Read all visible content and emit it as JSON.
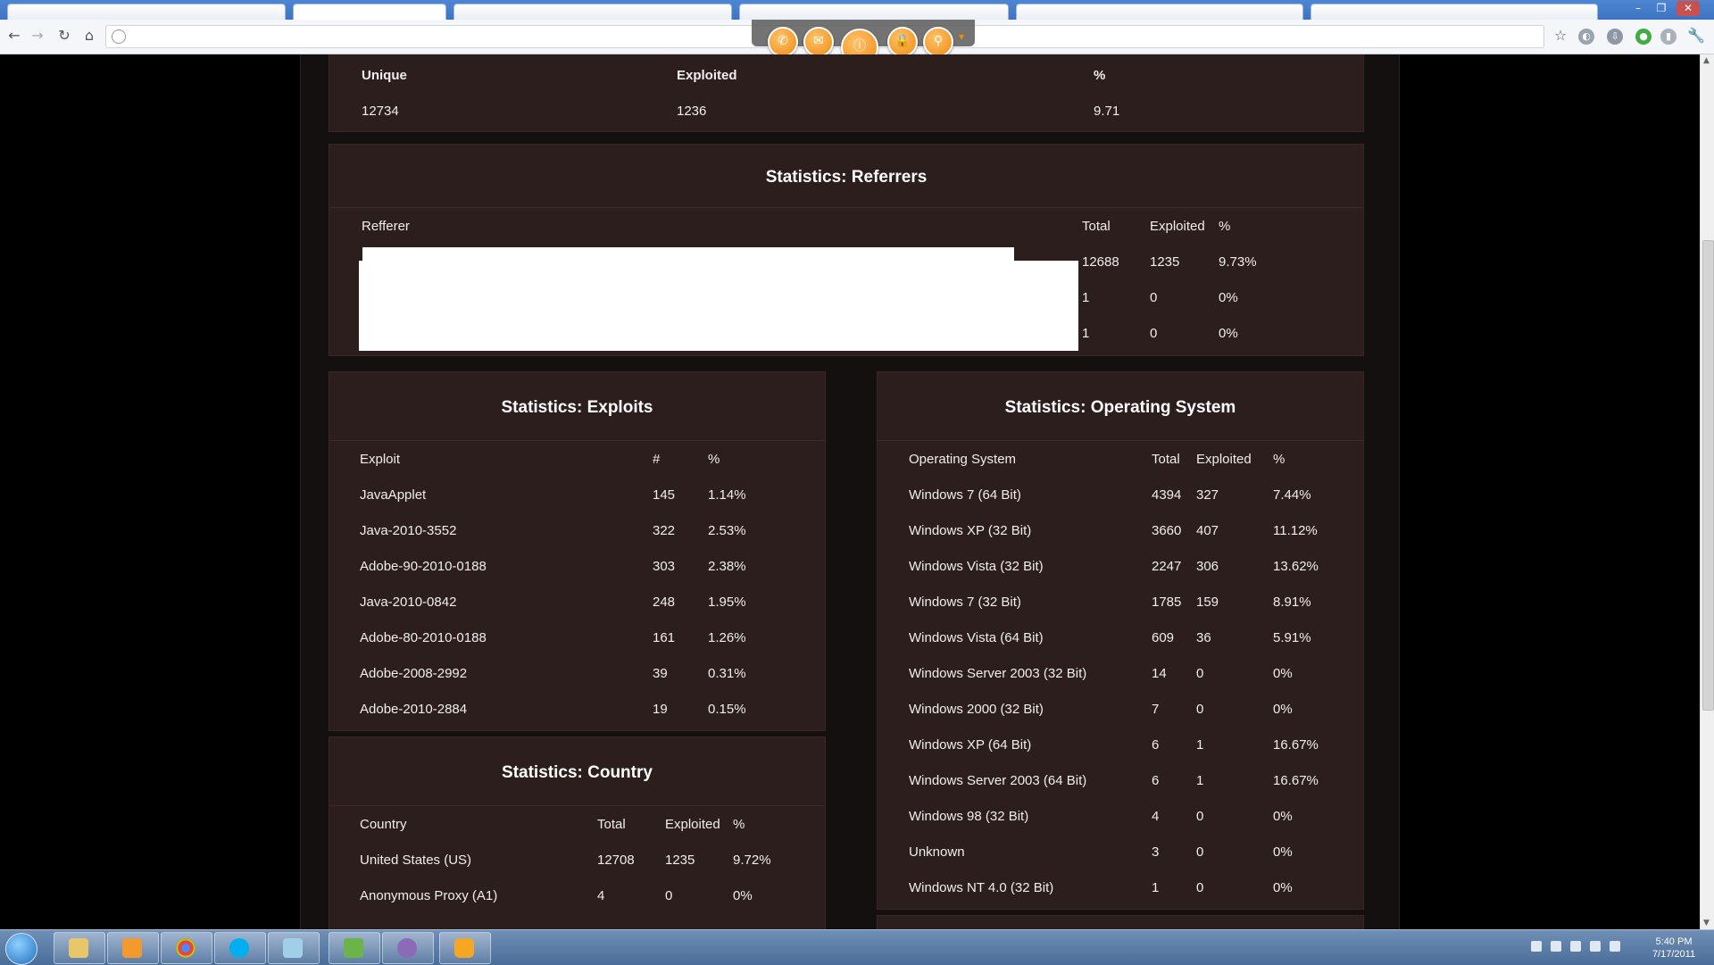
{
  "browser": {
    "toolbar_icons": [
      "back-icon",
      "forward-icon",
      "reload-icon",
      "home-icon"
    ],
    "right_icons": [
      "star-icon",
      "globe-icon",
      "download-icon",
      "green-extension-icon",
      "signal-icon",
      "wrench-icon"
    ],
    "overlay_icons": [
      "phone-icon",
      "chat-icon",
      "broadcast-icon",
      "lock-icon",
      "mouse-icon"
    ]
  },
  "summary": {
    "headers": [
      "Unique",
      "Exploited",
      "%"
    ],
    "values": [
      "12734",
      "1236",
      "9.71"
    ]
  },
  "referrers": {
    "title": "Statistics: Referrers",
    "headers": [
      "Refferer",
      "Total",
      "Exploited",
      "%"
    ],
    "rows": [
      {
        "total": "12688",
        "exploited": "1235",
        "pct": "9.73%"
      },
      {
        "total": "1",
        "exploited": "0",
        "pct": "0%"
      },
      {
        "total": "1",
        "exploited": "0",
        "pct": "0%"
      }
    ]
  },
  "exploits": {
    "title": "Statistics: Exploits",
    "headers": [
      "Exploit",
      "#",
      "%"
    ],
    "rows": [
      [
        "JavaApplet",
        "145",
        "1.14%"
      ],
      [
        "Java-2010-3552",
        "322",
        "2.53%"
      ],
      [
        "Adobe-90-2010-0188",
        "303",
        "2.38%"
      ],
      [
        "Java-2010-0842",
        "248",
        "1.95%"
      ],
      [
        "Adobe-80-2010-0188",
        "161",
        "1.26%"
      ],
      [
        "Adobe-2008-2992",
        "39",
        "0.31%"
      ],
      [
        "Adobe-2010-2884",
        "19",
        "0.15%"
      ]
    ]
  },
  "country": {
    "title": "Statistics: Country",
    "headers": [
      "Country",
      "Total",
      "Exploited",
      "%"
    ],
    "rows": [
      [
        "United States (US)",
        "12708",
        "1235",
        "9.72%"
      ],
      [
        "Anonymous Proxy (A1)",
        "4",
        "0",
        "0%"
      ]
    ]
  },
  "os": {
    "title": "Statistics: Operating System",
    "headers": [
      "Operating System",
      "Total",
      "Exploited",
      "%"
    ],
    "rows": [
      [
        "Windows 7 (64 Bit)",
        "4394",
        "327",
        "7.44%"
      ],
      [
        "Windows XP (32 Bit)",
        "3660",
        "407",
        "11.12%"
      ],
      [
        "Windows Vista (32 Bit)",
        "2247",
        "306",
        "13.62%"
      ],
      [
        "Windows 7 (32 Bit)",
        "1785",
        "159",
        "8.91%"
      ],
      [
        "Windows Vista (64 Bit)",
        "609",
        "36",
        "5.91%"
      ],
      [
        "Windows Server 2003 (32 Bit)",
        "14",
        "0",
        "0%"
      ],
      [
        "Windows 2000 (32 Bit)",
        "7",
        "0",
        "0%"
      ],
      [
        "Windows XP (64 Bit)",
        "6",
        "1",
        "16.67%"
      ],
      [
        "Windows Server 2003 (64 Bit)",
        "6",
        "1",
        "16.67%"
      ],
      [
        "Windows 98 (32 Bit)",
        "4",
        "0",
        "0%"
      ],
      [
        "Unknown",
        "3",
        "0",
        "0%"
      ],
      [
        "Windows NT 4.0 (32 Bit)",
        "1",
        "0",
        "0%"
      ]
    ]
  },
  "taskbar": {
    "apps": [
      "file-explorer-icon",
      "media-player-icon",
      "chrome-icon",
      "skype-icon",
      "notepad-icon",
      "spreadsheet-icon",
      "pidgin-icon",
      "joinme-icon"
    ],
    "clock_time": "5:40 PM",
    "clock_date": "7/17/2011"
  },
  "colors": {
    "panel_bg": "#2d1e1e",
    "page_bg": "#141010",
    "overlay_accent": "#f08a12"
  }
}
